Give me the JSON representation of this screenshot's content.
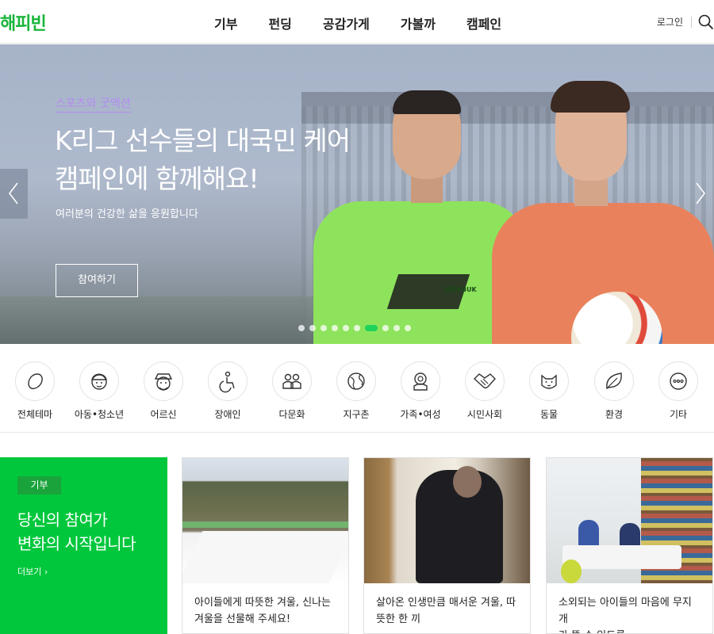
{
  "header": {
    "logo": "해피빈",
    "nav": [
      "기부",
      "펀딩",
      "공감가게",
      "가볼까",
      "캠페인"
    ],
    "login": "로그인",
    "search_icon": "search-icon"
  },
  "hero": {
    "category": "스포츠와 굿액션",
    "title_line1": "K리그 선수들의 대국민 케어",
    "title_line2": "캠페인에 함께해요!",
    "subtitle": "여러분의 건강한 삶을 응원합니다",
    "button": "참여하기",
    "jersey_text": "JEONBUK",
    "dot_count": 10,
    "active_dot": 7,
    "accent_color": "#1fd35a"
  },
  "categories": [
    {
      "label": "전체테마",
      "icon": "egg-icon"
    },
    {
      "label": "아동•청소년",
      "icon": "child-icon"
    },
    {
      "label": "어르신",
      "icon": "elder-icon"
    },
    {
      "label": "장애인",
      "icon": "wheelchair-icon"
    },
    {
      "label": "다문화",
      "icon": "people-icon"
    },
    {
      "label": "지구촌",
      "icon": "globe-icon"
    },
    {
      "label": "가족•여성",
      "icon": "family-icon"
    },
    {
      "label": "시민사회",
      "icon": "handshake-icon"
    },
    {
      "label": "동물",
      "icon": "cat-icon"
    },
    {
      "label": "환경",
      "icon": "leaf-icon"
    },
    {
      "label": "기타",
      "icon": "more-icon"
    }
  ],
  "promo": {
    "badge": "기부",
    "title_line1": "당신의 참여가",
    "title_line2": "변화의 시작입니다",
    "more": "더보기 ›",
    "color": "#00c73c"
  },
  "cards": [
    {
      "title_line1": "아이들에게 따뜻한 겨울, 신나는",
      "title_line2": "겨울을 선물해 주세요!"
    },
    {
      "title_line1": "살아온 인생만큼 매서운 겨울, 따",
      "title_line2": "뜻한 한 끼"
    },
    {
      "title_line1": "소외되는 아이들의 마음에 무지개",
      "title_line2": "가 뜰 수 있도록"
    }
  ]
}
